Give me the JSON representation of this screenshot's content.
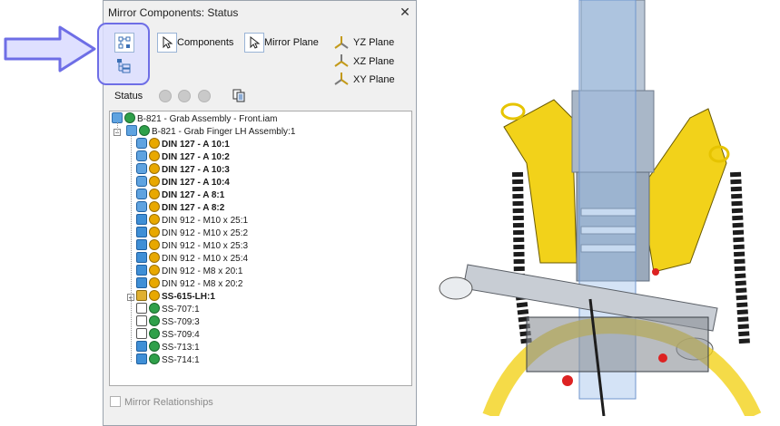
{
  "dialog": {
    "title": "Mirror Components: Status",
    "close_glyph": "✕",
    "buttons": {
      "components": "Components",
      "mirror_plane": "Mirror Plane",
      "yz_plane": "YZ Plane",
      "xz_plane": "XZ Plane",
      "xy_plane": "XY Plane"
    },
    "status_label": "Status",
    "tree": [
      {
        "label": "B-821 - Grab Assembly - Front.iam",
        "bold": false,
        "icon": "assembly-icon",
        "status": "reuse"
      },
      {
        "label": "B-821 - Grab Finger LH Assembly:1",
        "bold": false,
        "icon": "assembly-icon",
        "status": "reuse"
      },
      {
        "label": "DIN 127 - A 10:1",
        "bold": true,
        "icon": "standard-part-icon",
        "status": "mirror"
      },
      {
        "label": "DIN 127 - A 10:2",
        "bold": true,
        "icon": "standard-part-icon",
        "status": "mirror"
      },
      {
        "label": "DIN 127 - A 10:3",
        "bold": true,
        "icon": "standard-part-icon",
        "status": "mirror"
      },
      {
        "label": "DIN 127 - A 10:4",
        "bold": true,
        "icon": "standard-part-icon",
        "status": "mirror"
      },
      {
        "label": "DIN 127 - A 8:1",
        "bold": true,
        "icon": "standard-part-icon",
        "status": "mirror"
      },
      {
        "label": "DIN 127 - A 8:2",
        "bold": true,
        "icon": "standard-part-icon",
        "status": "mirror"
      },
      {
        "label": "DIN 912 - M10 x 25:1",
        "bold": false,
        "icon": "part-icon",
        "status": "mirror"
      },
      {
        "label": "DIN 912 - M10 x 25:2",
        "bold": false,
        "icon": "part-icon",
        "status": "mirror"
      },
      {
        "label": "DIN 912 - M10 x 25:3",
        "bold": false,
        "icon": "part-icon",
        "status": "mirror"
      },
      {
        "label": "DIN 912 - M10 x 25:4",
        "bold": false,
        "icon": "part-icon",
        "status": "mirror"
      },
      {
        "label": "DIN 912 - M8 x 20:1",
        "bold": false,
        "icon": "part-icon",
        "status": "mirror"
      },
      {
        "label": "DIN 912 - M8 x 20:2",
        "bold": false,
        "icon": "part-icon",
        "status": "mirror"
      },
      {
        "label": "SS-615-LH:1",
        "bold": true,
        "icon": "weldment-icon",
        "status": "mirror"
      },
      {
        "label": "SS-707:1",
        "bold": false,
        "icon": "sheetmetal-icon",
        "status": "reuse"
      },
      {
        "label": "SS-709:3",
        "bold": false,
        "icon": "sheetmetal-icon",
        "status": "reuse"
      },
      {
        "label": "SS-709:4",
        "bold": false,
        "icon": "sheetmetal-icon",
        "status": "reuse"
      },
      {
        "label": "SS-713:1",
        "bold": false,
        "icon": "part-icon",
        "status": "reuse"
      },
      {
        "label": "SS-714:1",
        "bold": false,
        "icon": "part-icon",
        "status": "reuse"
      }
    ],
    "mirror_relationships_label": "Mirror Relationships"
  },
  "colors": {
    "accent": "#6e6ee6",
    "reuse_green": "#2fa04a",
    "mirror_yellow": "#e8a800",
    "part_blue": "#3f8fd6",
    "cad_yellow": "#f2d21a"
  }
}
